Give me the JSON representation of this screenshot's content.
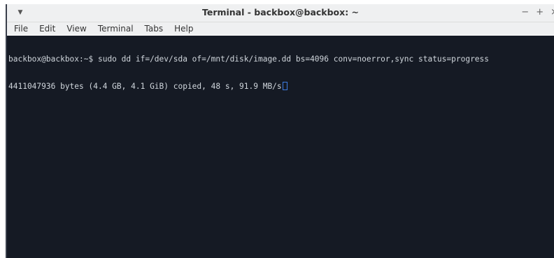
{
  "window": {
    "title": "Terminal - backbox@backbox: ~",
    "menu_button_icon": "chevron-down-icon",
    "controls": {
      "minimize": "−",
      "maximize": "+",
      "close": "×"
    }
  },
  "menubar": {
    "items": [
      "File",
      "Edit",
      "View",
      "Terminal",
      "Tabs",
      "Help"
    ]
  },
  "terminal": {
    "background": "#151a24",
    "foreground": "#d0d6dc",
    "cursor_color": "#3d7be0",
    "lines": [
      "backbox@backbox:~$ sudo dd if=/dev/sda of=/mnt/disk/image.dd bs=4096 conv=noerror,sync status=progress",
      "4411047936 bytes (4.4 GB, 4.1 GiB) copied, 48 s, 91.9 MB/s"
    ]
  }
}
